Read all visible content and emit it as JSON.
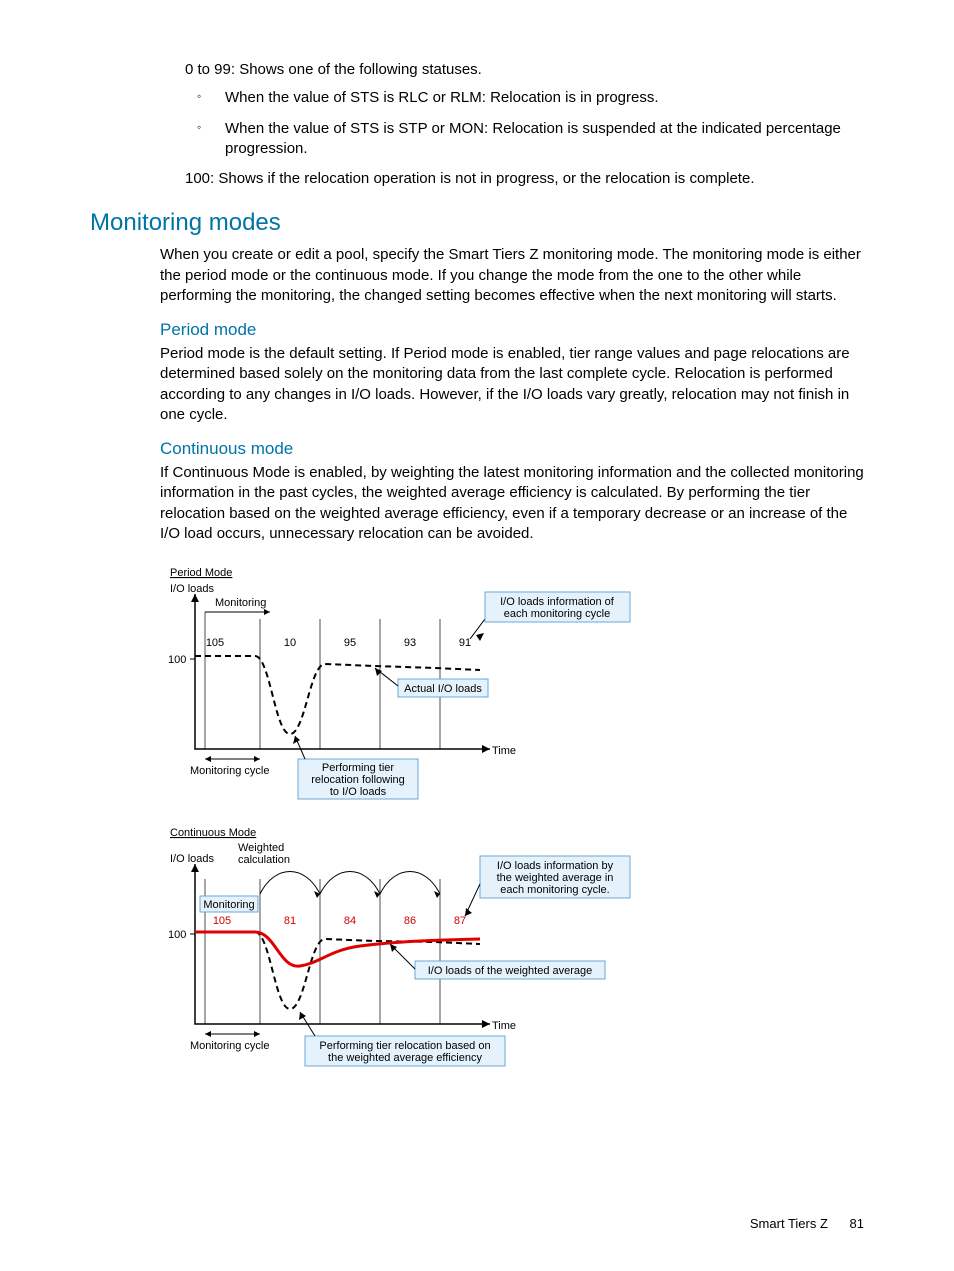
{
  "top": {
    "line1": "0 to 99: Shows one of the following statuses.",
    "bullets": [
      "When the value of STS is RLC or RLM: Relocation is in progress.",
      "When the value of STS is STP or MON: Relocation is suspended at the indicated percentage progression."
    ],
    "line2": "100: Shows if the relocation operation is not in progress, or the relocation is complete."
  },
  "monitoring": {
    "heading": "Monitoring modes",
    "para": "When you create or edit a pool, specify the Smart Tiers Z monitoring mode. The monitoring mode is either the period mode or the continuous mode. If you change the mode from the one to the other while performing the monitoring, the changed setting becomes effective when the next monitoring will starts."
  },
  "period": {
    "heading": "Period mode",
    "para": "Period mode is the default setting. If Period mode is enabled, tier range values and page relocations are determined based solely on the monitoring data from the last complete cycle. Relocation is performed according to any changes in I/O loads. However, if the I/O loads vary greatly, relocation may not finish in one cycle."
  },
  "continuous": {
    "heading": "Continuous mode",
    "para": "If Continuous Mode is enabled, by weighting the latest monitoring information and the collected monitoring information in the past cycles, the weighted average efficiency is calculated. By performing the tier relocation based on the weighted average efficiency, even if a temporary decrease or an increase of the I/O load occurs, unnecessary relocation can be avoided."
  },
  "chart_data": [
    {
      "type": "line",
      "title": "Period Mode",
      "ylabel": "I/O loads",
      "xlabel": "Time",
      "y_axis_tick": 100,
      "annotations": {
        "monitoring": "Monitoring",
        "monitoring_cycle": "Monitoring cycle",
        "info_box": "I/O loads information of each monitoring cycle",
        "actual_box": "Actual I/O loads",
        "relocation_box": "Performing tier relocation following to I/O loads"
      },
      "values": [
        105,
        10,
        95,
        93,
        91
      ]
    },
    {
      "type": "line",
      "title": "Continuous Mode",
      "ylabel": "I/O loads",
      "xlabel": "Time",
      "y_axis_tick": 100,
      "annotations": {
        "weighted": "Weighted calculation",
        "monitoring": "Monitoring",
        "monitoring_cycle": "Monitoring cycle",
        "info_box": "I/O loads information by the weighted average in each monitoring cycle.",
        "avg_box": "I/O loads of the weighted average",
        "relocation_box": "Performing tier relocation based on the weighted average efficiency"
      },
      "values": [
        105,
        81,
        84,
        86,
        87
      ]
    }
  ],
  "footer": {
    "text": "Smart Tiers Z",
    "page": "81"
  }
}
